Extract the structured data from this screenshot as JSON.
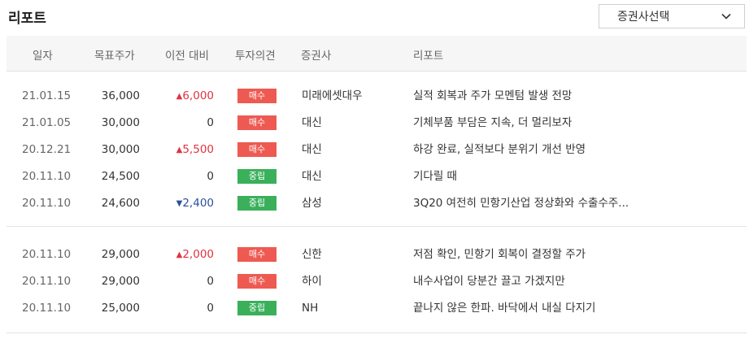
{
  "title": "리포트",
  "filter": {
    "label": "증권사선택"
  },
  "columns": {
    "date": "일자",
    "target": "목표주가",
    "change": "이전 대비",
    "opinion": "투자의견",
    "broker": "증권사",
    "report": "리포트"
  },
  "colors": {
    "up": "#e1323f",
    "down": "#2c4f9e",
    "buy_badge": "#ee5a52",
    "hold_badge": "#3ab05b"
  },
  "groups": [
    {
      "rows": [
        {
          "date": "21.01.15",
          "target": "36,000",
          "dir": "up",
          "change": "6,000",
          "opinion": "매수",
          "opinion_type": "buy",
          "broker": "미래에셋대우",
          "report": "실적 회복과 주가 모멘텀 발생 전망"
        },
        {
          "date": "21.01.05",
          "target": "30,000",
          "dir": "none",
          "change": "0",
          "opinion": "매수",
          "opinion_type": "buy",
          "broker": "대신",
          "report": "기체부품 부담은 지속, 더 멀리보자"
        },
        {
          "date": "20.12.21",
          "target": "30,000",
          "dir": "up",
          "change": "5,500",
          "opinion": "매수",
          "opinion_type": "buy",
          "broker": "대신",
          "report": "하강 완료, 실적보다 분위기 개선 반영"
        },
        {
          "date": "20.11.10",
          "target": "24,500",
          "dir": "none",
          "change": "0",
          "opinion": "중립",
          "opinion_type": "hold",
          "broker": "대신",
          "report": "기다릴 때"
        },
        {
          "date": "20.11.10",
          "target": "24,600",
          "dir": "down",
          "change": "2,400",
          "opinion": "중립",
          "opinion_type": "hold",
          "broker": "삼성",
          "report": "3Q20 여전히 민항기산업 정상화와 수출수주..."
        }
      ]
    },
    {
      "rows": [
        {
          "date": "20.11.10",
          "target": "29,000",
          "dir": "up",
          "change": "2,000",
          "opinion": "매수",
          "opinion_type": "buy",
          "broker": "신한",
          "report": "저점 확인, 민항기 회복이 결정할 주가"
        },
        {
          "date": "20.11.10",
          "target": "29,000",
          "dir": "none",
          "change": "0",
          "opinion": "매수",
          "opinion_type": "buy",
          "broker": "하이",
          "report": "내수사업이 당분간 끌고 가겠지만"
        },
        {
          "date": "20.11.10",
          "target": "25,000",
          "dir": "none",
          "change": "0",
          "opinion": "중립",
          "opinion_type": "hold",
          "broker": "NH",
          "report": "끝나지 않은 한파. 바닥에서 내실 다지기"
        }
      ]
    }
  ]
}
